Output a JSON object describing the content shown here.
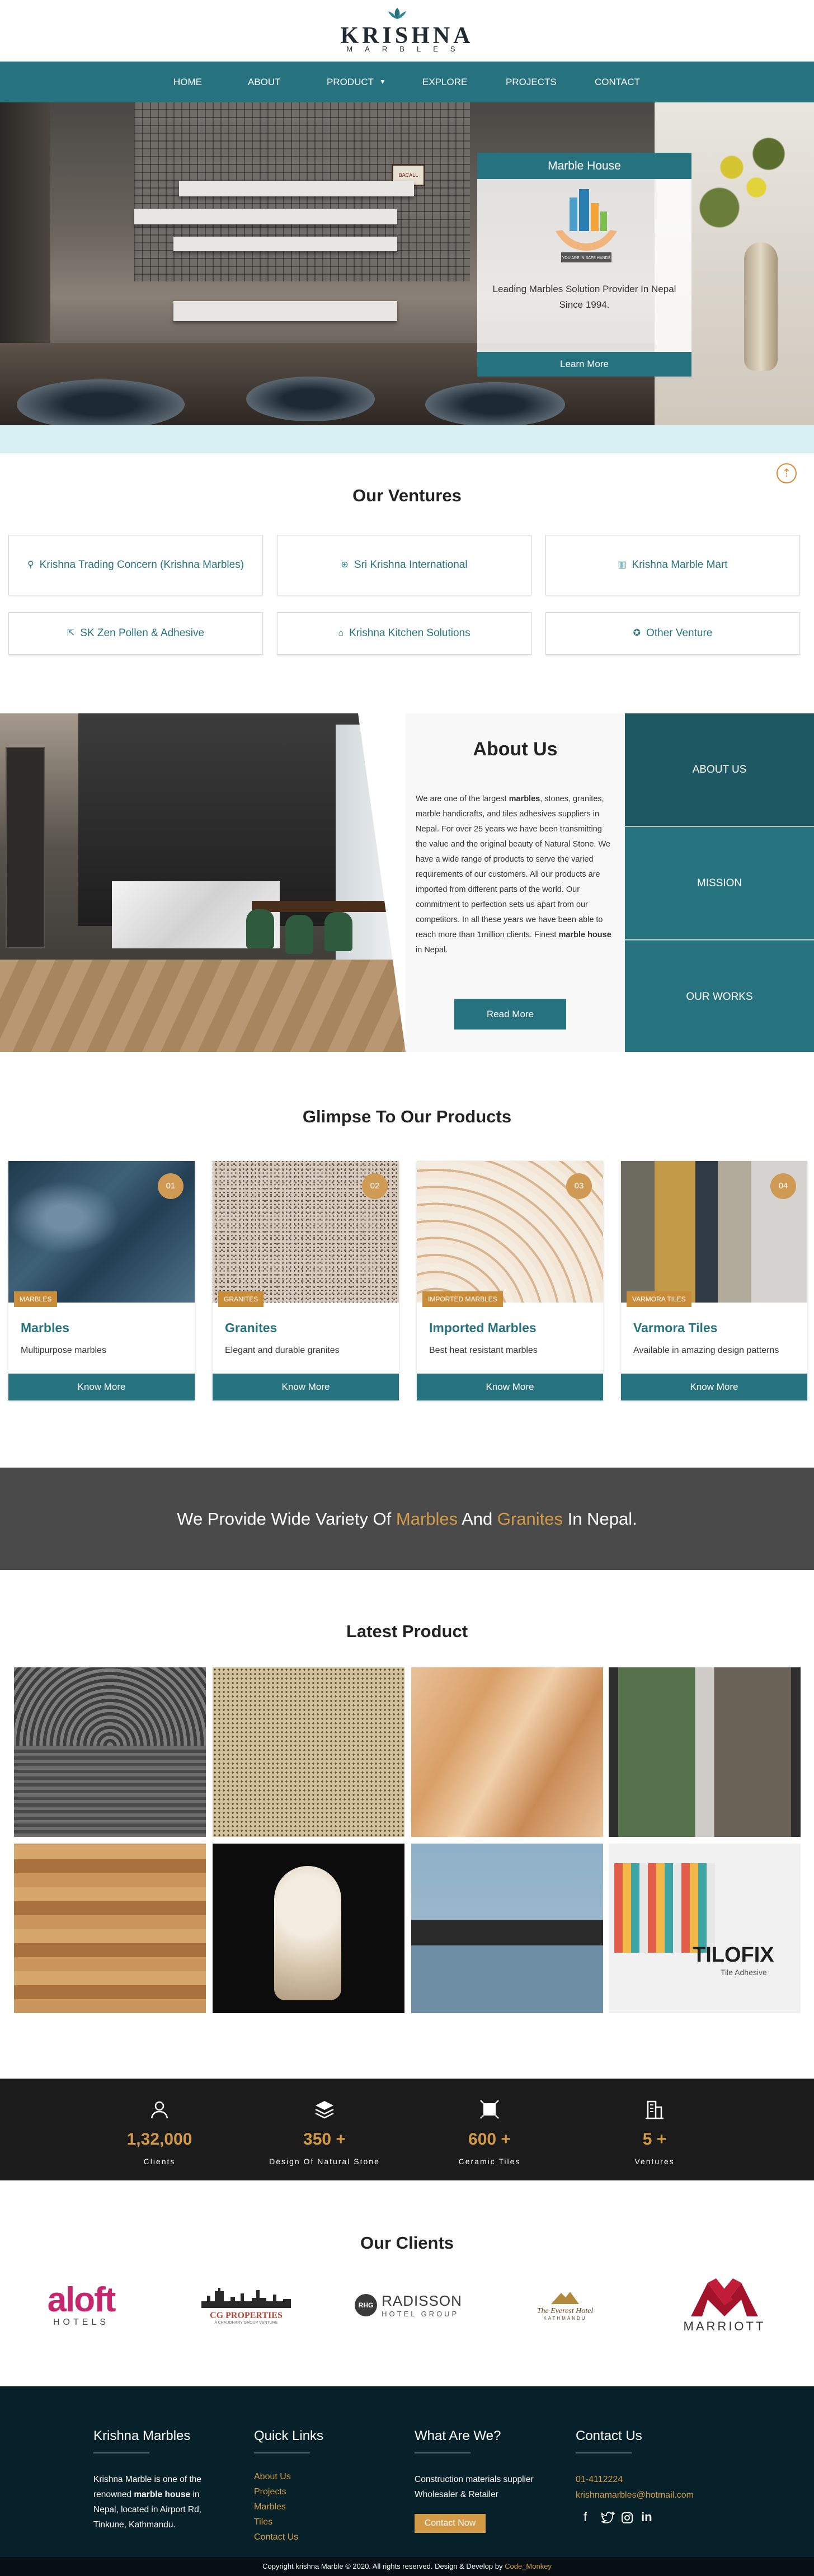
{
  "brand": {
    "name": "KRISHNA",
    "sub": "MARBLES"
  },
  "nav": [
    "HOME",
    "ABOUT",
    "PRODUCT",
    "EXPLORE",
    "PROJECTS",
    "CONTACT"
  ],
  "hero": {
    "card_title": "Marble House",
    "card_badge": "YOU ARE IN SAFE HANDS",
    "card_text": "Leading Marbles Solution Provider In Nepal Since 1994.",
    "card_button": "Learn More",
    "plaque": "BACALL"
  },
  "ventures": {
    "title": "Our Ventures",
    "items": [
      {
        "label": "Krishna Trading Concern (Krishna Marbles)",
        "icon": "pin-icon"
      },
      {
        "label": "Sri Krishna International",
        "icon": "globe-icon"
      },
      {
        "label": "Krishna Marble Mart",
        "icon": "building-icon"
      },
      {
        "label": "SK Zen Pollen & Adhesive",
        "icon": "external-icon"
      },
      {
        "label": "Krishna Kitchen Solutions",
        "icon": "home-icon"
      },
      {
        "label": "Other Venture",
        "icon": "badge-icon"
      }
    ]
  },
  "about": {
    "title": "About Us",
    "p1": "We are one of the largest ",
    "b1": "marbles",
    "p2": ", stones, granites, marble handicrafts, and tiles adhesives suppliers in Nepal. For over 25 years we have been transmitting the value and the original beauty of Natural Stone. We have a wide range of products to serve the varied requirements of our customers. All our products are imported from different parts of the world. Our commitment to perfection sets us apart from our competitors. In all these years we have been able to reach more than 1million clients. Finest ",
    "b2": "marble house",
    "p3": " in Nepal.",
    "button": "Read More",
    "tabs": [
      "ABOUT US",
      "MISSION",
      "OUR WORKS"
    ]
  },
  "products": {
    "title": "Glimpse To Our Products",
    "items": [
      {
        "num": "01",
        "tag": "MARBLES",
        "name": "Marbles",
        "desc": "Multipurpose marbles",
        "button": "Know More"
      },
      {
        "num": "02",
        "tag": "GRANITES",
        "name": "Granites",
        "desc": "Elegant and durable granites",
        "button": "Know More"
      },
      {
        "num": "03",
        "tag": "IMPORTED MARBLES",
        "name": "Imported Marbles",
        "desc": "Best heat resistant marbles",
        "button": "Know More"
      },
      {
        "num": "04",
        "tag": "VARMORA TILES",
        "name": "Varmora Tiles",
        "desc": "Available in amazing design patterns",
        "button": "Know More"
      }
    ]
  },
  "banner": {
    "pre": "We Provide Wide Variety Of ",
    "h1": "Marbles",
    "mid": " And ",
    "h2": "Granites",
    "post": " In Nepal."
  },
  "latest": {
    "title": "Latest Product",
    "tile_brand": "TILOFIX",
    "tile_sub": "Tile Adhesive"
  },
  "stats": [
    {
      "num": "1,32,000",
      "label": "Clients",
      "icon": "user-icon"
    },
    {
      "num": "350 +",
      "label": "Design Of Natural Stone",
      "icon": "layers-icon"
    },
    {
      "num": "600 +",
      "label": "Ceramic Tiles",
      "icon": "tile-icon"
    },
    {
      "num": "5 +",
      "label": "Ventures",
      "icon": "building-icon"
    }
  ],
  "clients": {
    "title": "Our Clients",
    "aloft": "aloft",
    "aloft_sub": "HOTELS",
    "cg": "CG PROPERTIES",
    "cg_sub": "A CHAUDHARY GROUP VENTURE",
    "radisson": "RADISSON",
    "radisson_sub": "HOTEL GROUP",
    "radisson_mark": "RHG",
    "everest": "The Everest Hotel",
    "everest_sub": "KATHMANDU",
    "marriott": "MARRIOTT"
  },
  "footer": {
    "col1_title": "Krishna Marbles",
    "col1_a": "Krishna Marble is one of the renowned ",
    "col1_b": "marble house",
    "col1_c": " in Nepal, located in Airport Rd, Tinkune, Kathmandu.",
    "col2_title": "Quick Links",
    "links": [
      "About Us",
      "Projects",
      "Marbles",
      "Tiles",
      "Contact Us"
    ],
    "col3_title": "What Are We?",
    "col3_text": "Construction materials supplier Wholesaler & Retailer",
    "col3_button": "Contact Now",
    "col4_title": "Contact Us",
    "phone": "01-4112224",
    "email": "krishnamarbles@hotmail.com",
    "copy_pre": "Copyright krishna Marble © 2020. All rights reserved. Design & Develop by ",
    "copy_link": "Code_Monkey"
  }
}
